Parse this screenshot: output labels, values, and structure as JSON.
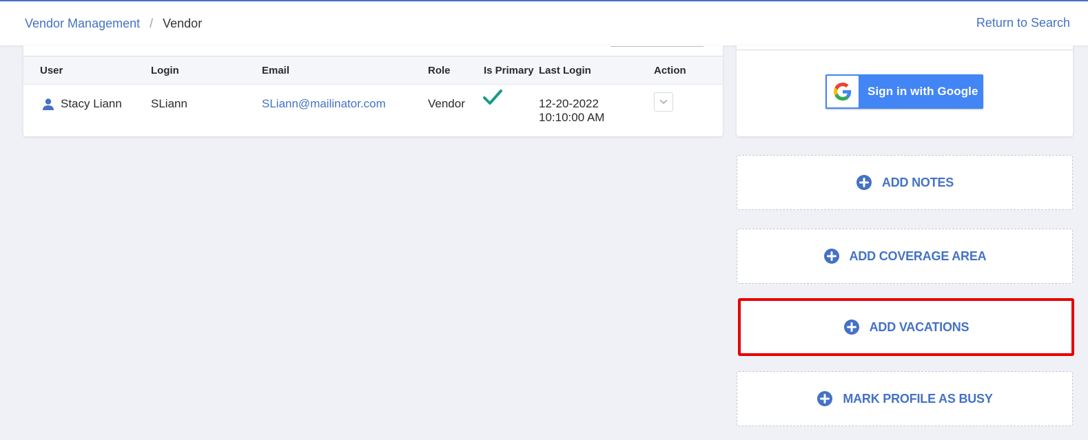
{
  "breadcrumb": {
    "parent": "Vendor Management",
    "separator": "/",
    "current": "Vendor"
  },
  "header": {
    "return_label": "Return to Search"
  },
  "users_table": {
    "columns": [
      "User",
      "Login",
      "Email",
      "Role",
      "Is Primary",
      "Last Login",
      "Action"
    ],
    "rows": [
      {
        "user": "Stacy Liann",
        "login": "SLiann",
        "email": "SLiann@mailinator.com",
        "role": "Vendor",
        "is_primary": true,
        "last_login_date": "12-20-2022",
        "last_login_time": "10:10:00 AM"
      }
    ]
  },
  "google": {
    "label": "Sign in with Google"
  },
  "actions": {
    "add_notes": "ADD NOTES",
    "add_coverage_area": "ADD COVERAGE AREA",
    "add_vacations": "ADD VACATIONS",
    "mark_busy": "MARK PROFILE AS BUSY"
  },
  "colors": {
    "accent": "#4472c4",
    "check": "#1a9a8a",
    "highlight": "#e60000",
    "google_blue": "#4285f4",
    "background": "#f0f1f6"
  },
  "icons": {
    "user": "person-icon",
    "primary": "checkmark-icon",
    "action": "chevron-down-icon",
    "google": "google-g-icon",
    "add": "plus-circle-icon"
  }
}
